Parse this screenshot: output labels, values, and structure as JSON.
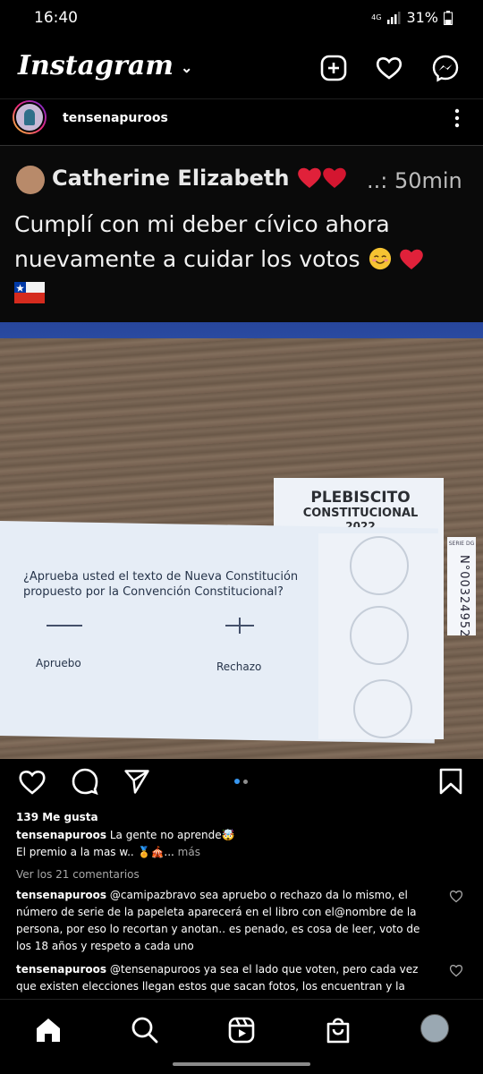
{
  "status_bar": {
    "time": "16:40",
    "network": "4G",
    "battery": "31%"
  },
  "app": {
    "name": "Instagram"
  },
  "post": {
    "username": "tensenapuroos",
    "screenshot": {
      "author": "Catherine Elizabeth",
      "time": "..: 50min",
      "text_line1": "Cumplí con mi deber cívico ahora",
      "text_line2": "nuevamente a cuidar los votos",
      "ballot": {
        "title1": "PLEBISCITO",
        "title2": "CONSTITUCIONAL",
        "year": "2022",
        "question_line1": "¿Aprueba usted el texto de Nueva Constitución",
        "question_line2": "propuesto por la Convención Constitucional?",
        "option_approve": "Apruebo",
        "option_reject": "Rechazo",
        "serie_label": "SERIE DG",
        "serial": "N°00324952"
      }
    },
    "likes": "139 Me gusta",
    "caption_user": "tensenapuroos",
    "caption_text1": "La gente no aprende🤯",
    "caption_text2": "El premio a la mas w.. 🏅🎪...",
    "more": "más",
    "view_comments": "Ver los 21 comentarios",
    "comments": [
      {
        "user": "tensenapuroos",
        "text": "@camipazbravo sea apruebo o rechazo da lo mismo, el número de serie de la papeleta aparecerá en el libro con el@nombre de la persona, por eso lo recortan y anotan.. es penado, es cosa de leer, voto de los 18 años y respeto a cada uno"
      },
      {
        "user": "tensenapuroos",
        "text": "@tensenapuroos ya sea el lado que voten, pero cada vez que existen elecciones llegan estos que sacan fotos, los encuentran y la multa es"
      }
    ]
  },
  "colors": {
    "background": "#000000",
    "text": "#ffffff",
    "muted": "#a8a8a8",
    "heart_red": "#e0213a",
    "carousel_active": "#3897f0"
  }
}
